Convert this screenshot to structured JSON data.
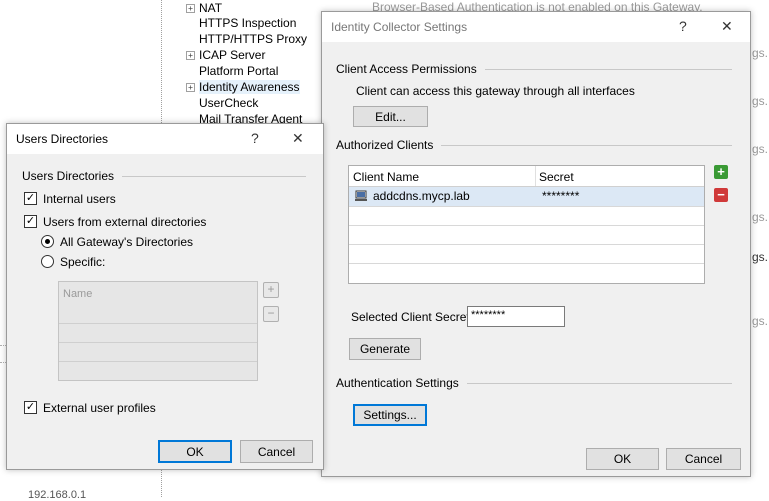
{
  "background": {
    "tree_items": [
      {
        "label": "NAT",
        "expandable": true
      },
      {
        "label": "HTTPS Inspection",
        "expandable": false
      },
      {
        "label": "HTTP/HTTPS Proxy",
        "expandable": false
      },
      {
        "label": "ICAP Server",
        "expandable": true
      },
      {
        "label": "Platform Portal",
        "expandable": false
      },
      {
        "label": "Identity Awareness",
        "expandable": true
      },
      {
        "label": "UserCheck",
        "expandable": false
      },
      {
        "label": "Mail Transfer Agent",
        "expandable": false
      }
    ],
    "browser_auth_note": "Browser-Based Authentication is not enabled on this Gateway.",
    "side_fragments": [
      "gs...",
      "gs...",
      "gs...",
      "gs...",
      "gs...",
      "gs..."
    ],
    "bottom_fragment": "192.168.0.1"
  },
  "identity_dialog": {
    "title": "Identity Collector Settings",
    "help": "?",
    "close": "✕",
    "client_access": {
      "header": "Client Access Permissions",
      "text": "Client can access this gateway through all interfaces",
      "edit_button": "Edit..."
    },
    "authorized_clients": {
      "header": "Authorized Clients",
      "columns": [
        "Client Name",
        "Secret"
      ],
      "rows": [
        {
          "name": "addcdns.mycp.lab",
          "secret": "********"
        }
      ],
      "add_icon": "+",
      "remove_icon": "−"
    },
    "selected_secret_label": "Selected Client Secret:",
    "selected_secret_value": "********",
    "generate_button": "Generate",
    "auth_settings": {
      "header": "Authentication Settings",
      "settings_button": "Settings..."
    },
    "ok_button": "OK",
    "cancel_button": "Cancel"
  },
  "users_dialog": {
    "title": "Users Directories",
    "help": "?",
    "close": "✕",
    "group_header": "Users Directories",
    "internal_users": {
      "label": "Internal users",
      "checked": true
    },
    "external_dirs": {
      "label": "Users from external directories",
      "checked": true
    },
    "radio_all": {
      "label": "All Gateway's Directories",
      "selected": true
    },
    "radio_specific": {
      "label": "Specific:",
      "selected": false
    },
    "list_header": "Name",
    "add_icon": "+",
    "remove_icon": "−",
    "external_profiles": {
      "label": "External user profiles",
      "checked": true
    },
    "ok_button": "OK",
    "cancel_button": "Cancel"
  }
}
